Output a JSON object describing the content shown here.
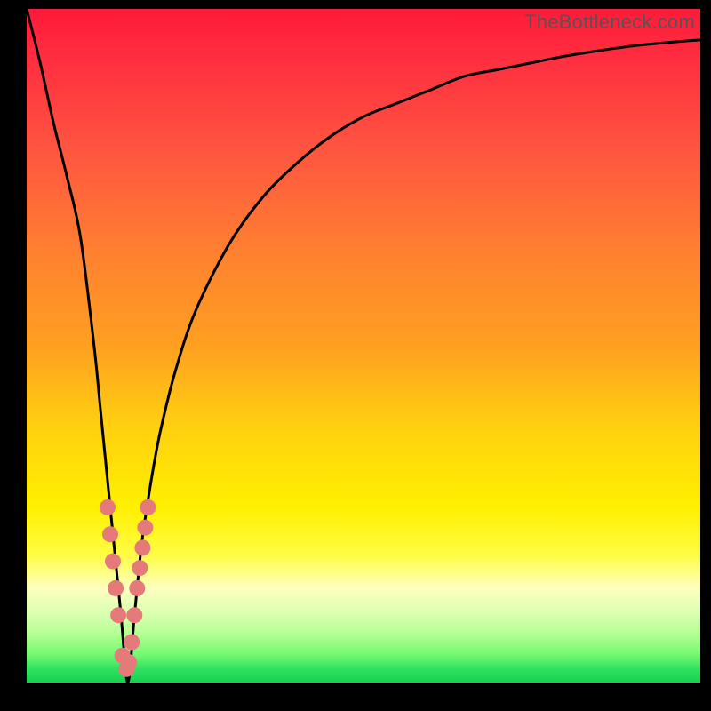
{
  "watermark": "TheBottleneck.com",
  "colors": {
    "frame": "#000000",
    "curve": "#000000",
    "marker_fill": "#e67a7a",
    "marker_stroke": "#b85050",
    "gradient_top": "#ff1a3a",
    "gradient_bottom": "#18d050"
  },
  "chart_data": {
    "type": "line",
    "title": "",
    "xlabel": "",
    "ylabel": "",
    "xlim": [
      0,
      100
    ],
    "ylim": [
      0,
      100
    ],
    "grid": false,
    "legend": "none",
    "notch_x": 15,
    "series": [
      {
        "name": "bottleneck-curve",
        "x": [
          0,
          2,
          4,
          6,
          8,
          10,
          11,
          12,
          13,
          14,
          15,
          16,
          17,
          18,
          19,
          20,
          22,
          25,
          30,
          35,
          40,
          45,
          50,
          55,
          60,
          65,
          70,
          75,
          80,
          85,
          90,
          95,
          100
        ],
        "y": [
          100,
          92,
          83,
          75,
          66,
          50,
          40,
          30,
          20,
          10,
          0,
          10,
          20,
          27,
          33,
          38,
          46,
          55,
          65,
          72,
          77,
          81,
          84,
          86,
          88,
          90,
          91,
          92,
          93,
          93.8,
          94.5,
          95,
          95.4
        ]
      }
    ],
    "markers": {
      "name": "highlight-points",
      "x": [
        12.0,
        12.4,
        12.8,
        13.2,
        13.6,
        14.2,
        14.8,
        15.2,
        15.6,
        16.0,
        16.4,
        16.8,
        17.2,
        17.6,
        18.0
      ],
      "y": [
        26,
        22,
        18,
        14,
        10,
        4,
        2,
        3,
        6,
        10,
        14,
        17,
        20,
        23,
        26
      ]
    }
  }
}
